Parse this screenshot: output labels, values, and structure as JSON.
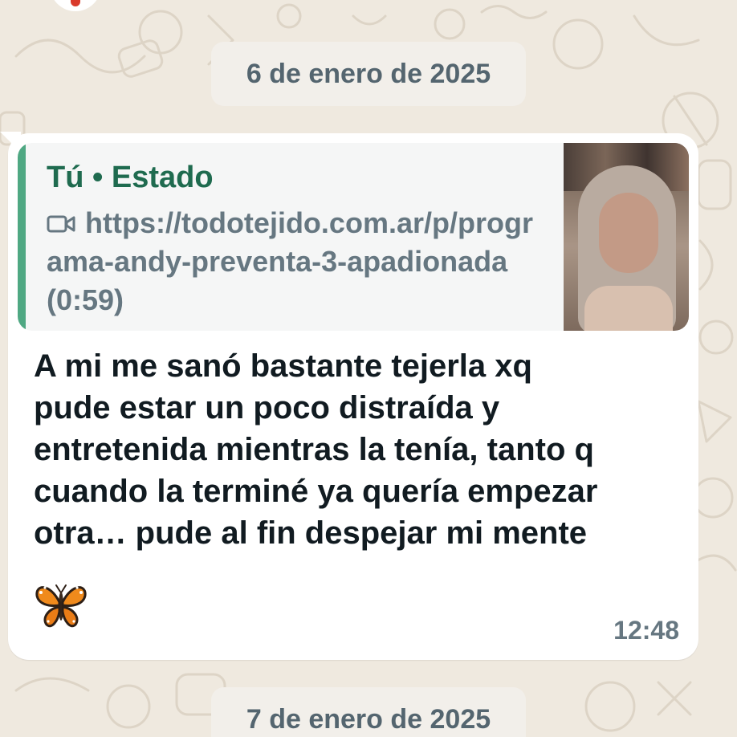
{
  "chat": {
    "date_separators": [
      "6 de enero de 2025",
      "7 de enero de 2025"
    ],
    "message": {
      "quoted": {
        "author": "Tú • Estado",
        "type_icon": "video-camera-icon",
        "text": "https://todotejido.com.ar/p/programa-andy-preventa-3-apadionada (0:59)"
      },
      "text": "A mi me sanó bastante tejerla xq\npude estar un poco distraída y\nentretenida mientras la tenía, tanto q\ncuando la terminé ya quería empezar\notra… pude al fin despejar mi mente",
      "emoji": "🦋",
      "time": "12:48"
    }
  },
  "colors": {
    "wallpaper": "#efe9df",
    "bubble": "#ffffff",
    "quote_bar": "#4fa883",
    "quote_author": "#1f6b4f",
    "meta": "#667781"
  }
}
